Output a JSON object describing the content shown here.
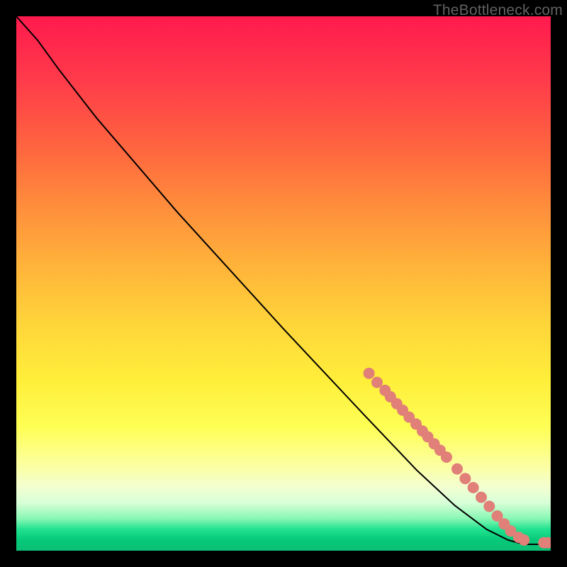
{
  "watermark": "TheBottleneck.com",
  "chart_data": {
    "type": "line",
    "title": "",
    "xlabel": "",
    "ylabel": "",
    "xlim": [
      0,
      100
    ],
    "ylim": [
      0,
      100
    ],
    "grid": false,
    "line": {
      "points": [
        {
          "x": 0.0,
          "y": 100.0
        },
        {
          "x": 4.0,
          "y": 95.5
        },
        {
          "x": 8.0,
          "y": 90.0
        },
        {
          "x": 15.0,
          "y": 81.0
        },
        {
          "x": 30.0,
          "y": 63.5
        },
        {
          "x": 50.0,
          "y": 41.5
        },
        {
          "x": 65.0,
          "y": 25.5
        },
        {
          "x": 75.0,
          "y": 15.0
        },
        {
          "x": 82.0,
          "y": 8.5
        },
        {
          "x": 88.0,
          "y": 4.0
        },
        {
          "x": 92.0,
          "y": 2.0
        },
        {
          "x": 95.0,
          "y": 1.2
        },
        {
          "x": 97.0,
          "y": 1.2
        },
        {
          "x": 100.0,
          "y": 1.2
        }
      ]
    },
    "markers": {
      "fill": "#e08078",
      "radius_px": 8,
      "points": [
        {
          "x": 66.0,
          "y": 33.2
        },
        {
          "x": 67.5,
          "y": 31.5
        },
        {
          "x": 69.0,
          "y": 30.0
        },
        {
          "x": 70.0,
          "y": 28.8
        },
        {
          "x": 71.2,
          "y": 27.5
        },
        {
          "x": 72.3,
          "y": 26.3
        },
        {
          "x": 73.5,
          "y": 25.0
        },
        {
          "x": 74.8,
          "y": 23.7
        },
        {
          "x": 76.0,
          "y": 22.4
        },
        {
          "x": 77.0,
          "y": 21.3
        },
        {
          "x": 78.2,
          "y": 20.0
        },
        {
          "x": 79.3,
          "y": 18.8
        },
        {
          "x": 80.5,
          "y": 17.5
        },
        {
          "x": 82.5,
          "y": 15.3
        },
        {
          "x": 84.0,
          "y": 13.5
        },
        {
          "x": 85.5,
          "y": 11.8
        },
        {
          "x": 87.0,
          "y": 10.0
        },
        {
          "x": 88.5,
          "y": 8.3
        },
        {
          "x": 90.0,
          "y": 6.5
        },
        {
          "x": 91.3,
          "y": 5.0
        },
        {
          "x": 92.5,
          "y": 3.7
        },
        {
          "x": 94.0,
          "y": 2.5
        },
        {
          "x": 95.0,
          "y": 2.0
        },
        {
          "x": 98.7,
          "y": 1.5
        },
        {
          "x": 99.5,
          "y": 1.5
        }
      ]
    }
  }
}
